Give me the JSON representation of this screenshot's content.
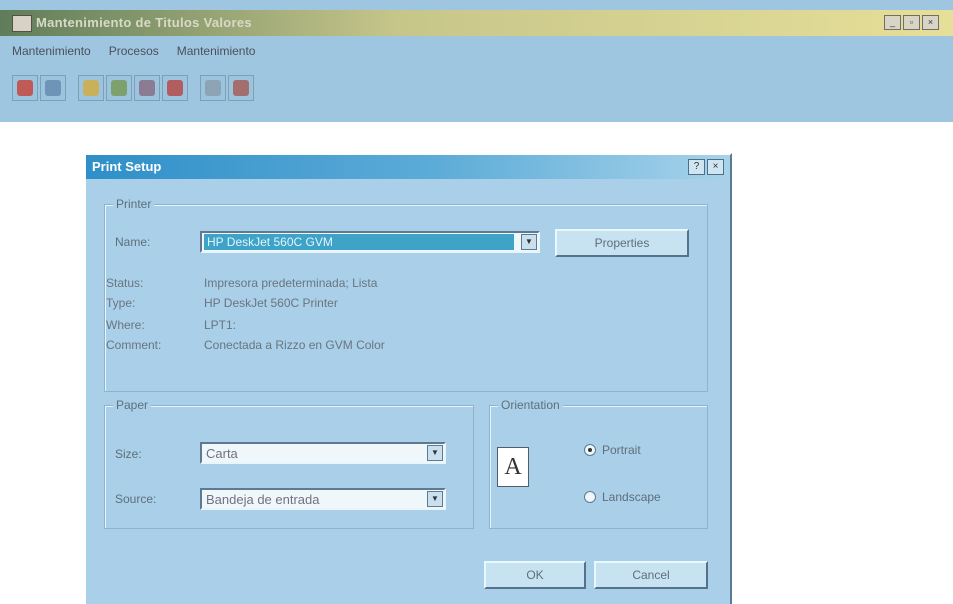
{
  "app": {
    "title": "Mantenimiento de Titulos Valores",
    "controls": [
      "_",
      "▫",
      "×"
    ],
    "menu": [
      "Mantenimiento",
      "Procesos",
      "Mantenimiento"
    ],
    "toolbar_icons": [
      "file-icon",
      "arrow-icon",
      "folder-icon",
      "people-icon",
      "report-icon",
      "print-icon",
      "calculator-icon",
      "exit-icon"
    ]
  },
  "dialog": {
    "title": "Print Setup",
    "help": "?",
    "close": "×",
    "printer": {
      "group_label": "Printer",
      "name_label": "Name:",
      "name_value": "HP DeskJet 560C GVM",
      "properties": "Properties",
      "status_label": "Status:",
      "status_value": "Impresora predeterminada; Lista",
      "type_label": "Type:",
      "type_value": "HP DeskJet 560C Printer",
      "where_label": "Where:",
      "where_value": "LPT1:",
      "comment_label": "Comment:",
      "comment_value": "Conectada a Rizzo en GVM Color"
    },
    "paper": {
      "group_label": "Paper",
      "size_label": "Size:",
      "size_value": "Carta",
      "source_label": "Source:",
      "source_value": "Bandeja de entrada"
    },
    "orientation": {
      "group_label": "Orientation",
      "portrait": "Portrait",
      "landscape": "Landscape",
      "selected": "portrait",
      "icon_letter": "A"
    },
    "buttons": {
      "ok": "OK",
      "cancel": "Cancel"
    }
  },
  "colors": {
    "title_gradient": [
      "#2f8fc8",
      "#a7d3ea"
    ],
    "dialog_bg": "#a9d0e8",
    "selection": "#3fa2c7"
  }
}
